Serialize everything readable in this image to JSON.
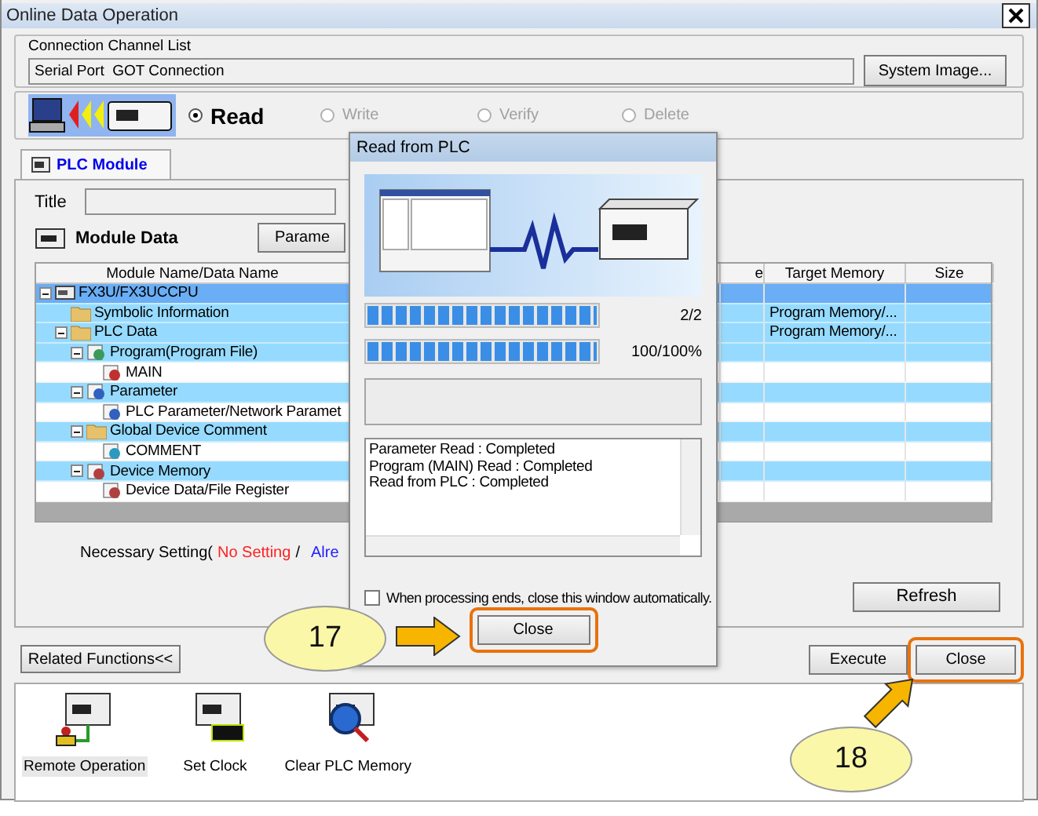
{
  "window": {
    "title": "Online Data Operation"
  },
  "connection": {
    "legend": "Connection Channel List",
    "value": "Serial Port  GOT Connection",
    "button": "System Image..."
  },
  "operations": [
    {
      "label": "Read",
      "selected": true,
      "disabled": false
    },
    {
      "label": "Write",
      "selected": false,
      "disabled": true
    },
    {
      "label": "Verify",
      "selected": false,
      "disabled": true
    },
    {
      "label": "Delete",
      "selected": false,
      "disabled": true
    }
  ],
  "tabs": [
    {
      "label": "PLC Module",
      "selected": true
    }
  ],
  "title_label": "Title",
  "module_data": {
    "label": "Module Data",
    "button": "Parame"
  },
  "table": {
    "columns": [
      {
        "label": "Module Name/Data Name"
      },
      {
        "label": "e"
      },
      {
        "label": "Target Memory"
      },
      {
        "label": "Size"
      }
    ],
    "rows": [
      {
        "name": "FX3U/FX3UCCPU",
        "kind": "cpu",
        "selected": true,
        "highlighted": true,
        "expanded": true,
        "children": [
          {
            "name": "Symbolic Information",
            "kind": "folder",
            "selected": false,
            "highlighted": true,
            "target_memory": "Program Memory/..."
          },
          {
            "name": "PLC Data",
            "kind": "folder",
            "selected": false,
            "highlighted": true,
            "expanded": true,
            "target_memory": "Program Memory/...",
            "children": [
              {
                "name": "Program(Program File)",
                "kind": "program",
                "selected": false,
                "highlighted": true,
                "expanded": true,
                "children": [
                  {
                    "name": "MAIN",
                    "kind": "file",
                    "selected": false,
                    "highlighted": false
                  }
                ]
              },
              {
                "name": "Parameter",
                "kind": "parameter",
                "selected": false,
                "highlighted": true,
                "expanded": true,
                "children": [
                  {
                    "name": "PLC Parameter/Network Paramet",
                    "kind": "parameter",
                    "selected": false,
                    "highlighted": false
                  }
                ]
              },
              {
                "name": "Global Device Comment",
                "kind": "folder",
                "selected": false,
                "highlighted": true,
                "expanded": true,
                "children": [
                  {
                    "name": "COMMENT",
                    "kind": "comment",
                    "selected": false,
                    "highlighted": false
                  }
                ]
              },
              {
                "name": "Device Memory",
                "kind": "memory",
                "selected": false,
                "highlighted": true,
                "expanded": true,
                "children": [
                  {
                    "name": "Device Data/File Register",
                    "kind": "memory",
                    "selected": false,
                    "highlighted": false
                  }
                ]
              }
            ]
          }
        ]
      }
    ]
  },
  "necessary_setting": {
    "label": "Necessary Setting(",
    "no_setting": "No Setting",
    "separator": "/",
    "already": "Alre"
  },
  "refresh_button": "Refresh",
  "related_button": "Related Functions<<",
  "execute_button": "Execute",
  "close_button": {
    "label": "Close",
    "highlighted": true,
    "callout": "18"
  },
  "related_functions": [
    {
      "label": "Remote Operation",
      "kind": "remote",
      "selected": true
    },
    {
      "label": "Set Clock",
      "kind": "clock",
      "selected": false
    },
    {
      "label": "Clear PLC Memory",
      "kind": "clear",
      "selected": false
    }
  ],
  "dialog": {
    "title": "Read from PLC",
    "progress": [
      {
        "level": 1,
        "reading": "2/2"
      },
      {
        "level": 1,
        "reading": "100/100%"
      }
    ],
    "log": [
      "Parameter Read : Completed",
      "Program (MAIN) Read : Completed",
      "Read from PLC : Completed"
    ],
    "auto_close": {
      "label": "When processing ends, close this window automatically.",
      "checked": false
    },
    "close_button": {
      "label": "Close",
      "highlighted": true,
      "callout": "17"
    }
  }
}
